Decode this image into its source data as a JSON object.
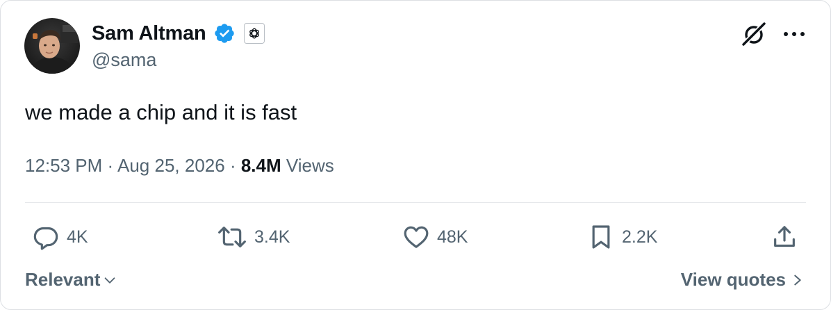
{
  "author": {
    "name": "Sam Altman",
    "handle": "@sama",
    "verified": true
  },
  "tweet": {
    "text": "we made a chip and it is fast",
    "time": "12:53 PM",
    "date": "Aug 25, 2026",
    "views_count": "8.4M",
    "views_label": "Views",
    "separator": "·"
  },
  "actions": {
    "replies": "4K",
    "reposts": "3.4K",
    "likes": "48K",
    "bookmarks": "2.2K"
  },
  "footer": {
    "sort_label": "Relevant",
    "quotes_label": "View quotes"
  },
  "colors": {
    "text": "#0f1419",
    "secondary": "#536471",
    "verified_blue": "#1d9bf0",
    "border": "#dcdfe3"
  },
  "icons": {
    "verified": "verified-badge-icon",
    "affiliate": "openai-logo-icon",
    "grok": "grok-icon",
    "more": "more-icon",
    "reply": "reply-icon",
    "repost": "repost-icon",
    "like": "heart-icon",
    "bookmark": "bookmark-icon",
    "share": "share-icon"
  }
}
